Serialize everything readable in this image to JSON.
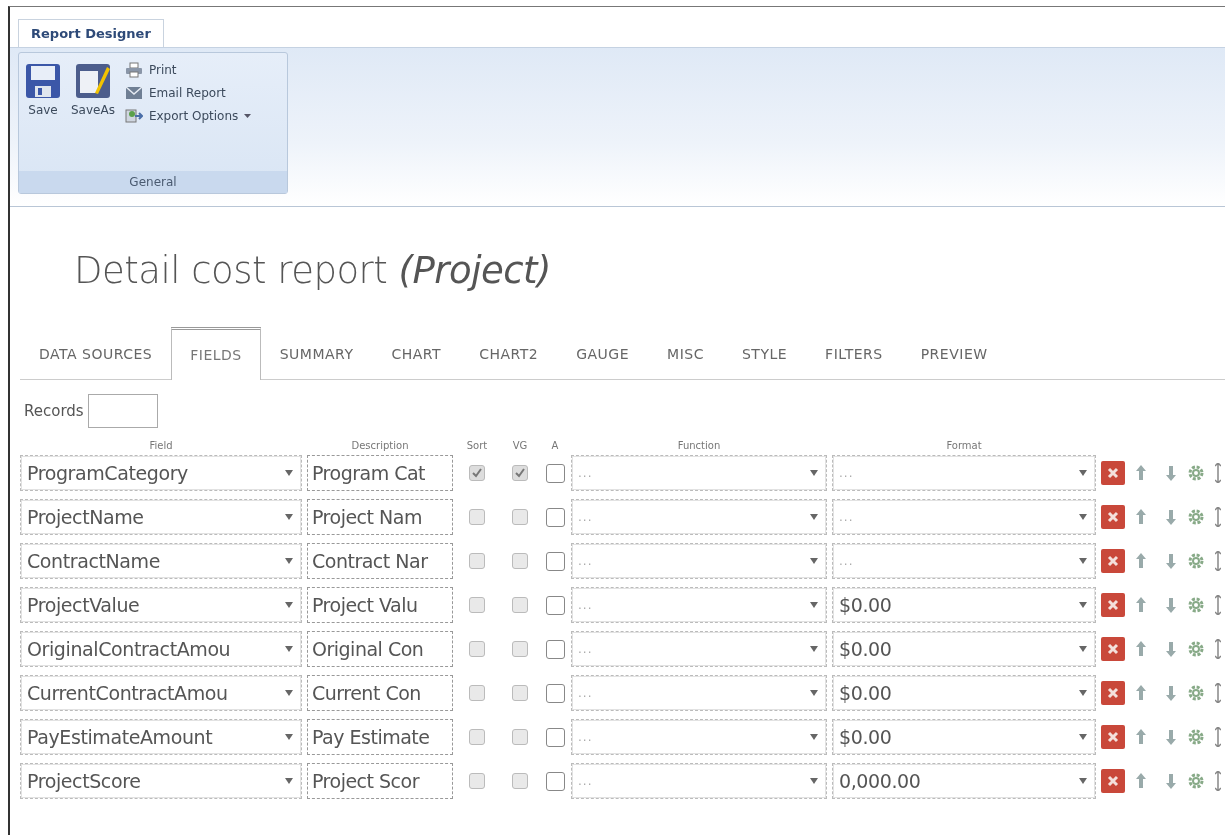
{
  "ribbon": {
    "tab": "Report Designer",
    "group": "General",
    "large_buttons": [
      {
        "kind": "save",
        "label": "Save"
      },
      {
        "kind": "saveas",
        "label": "SaveAs"
      }
    ],
    "small_buttons": [
      {
        "kind": "print",
        "label": "Print"
      },
      {
        "kind": "email",
        "label": "Email Report"
      },
      {
        "kind": "export",
        "label": "Export Options",
        "dropdown": true
      }
    ]
  },
  "title": "Detail cost report *(Project)*",
  "tabs": [
    {
      "label": "DATA SOURCES",
      "selected": false
    },
    {
      "label": "FIELDS",
      "selected": true
    },
    {
      "label": "SUMMARY",
      "selected": false
    },
    {
      "label": "CHART",
      "selected": false
    },
    {
      "label": "CHART2",
      "selected": false
    },
    {
      "label": "GAUGE",
      "selected": false
    },
    {
      "label": "MISC",
      "selected": false
    },
    {
      "label": "STYLE",
      "selected": false
    },
    {
      "label": "FILTERS",
      "selected": false
    },
    {
      "label": "PREVIEW",
      "selected": false
    }
  ],
  "records": {
    "label": "Records"
  },
  "columns": [
    "Field",
    "Description",
    "Sort",
    "VG",
    "A",
    "Function",
    "Format"
  ],
  "rows": [
    {
      "field": "ProgramCategory",
      "description": "Program Cat",
      "sort": true,
      "vg": true,
      "a": false,
      "function": {
        "placeholder": "..."
      },
      "format": {
        "placeholder": "..."
      }
    },
    {
      "field": "ProjectName",
      "description": "Project Nam",
      "sort": false,
      "vg": false,
      "a": false,
      "function": {
        "placeholder": "..."
      },
      "format": {
        "placeholder": "..."
      }
    },
    {
      "field": "ContractName",
      "description": "Contract Nar",
      "sort": false,
      "vg": false,
      "a": false,
      "function": {
        "placeholder": "..."
      },
      "format": {
        "placeholder": "..."
      }
    },
    {
      "field": "ProjectValue",
      "description": "Project Valu",
      "sort": false,
      "vg": false,
      "a": false,
      "function": {
        "placeholder": "..."
      },
      "format": {
        "value": "$0.00"
      }
    },
    {
      "field": "OriginalContractAmou",
      "description": "Original Con",
      "sort": false,
      "vg": false,
      "a": false,
      "function": {
        "placeholder": "..."
      },
      "format": {
        "value": "$0.00"
      }
    },
    {
      "field": "CurrentContractAmou",
      "description": "Current Con",
      "sort": false,
      "vg": false,
      "a": false,
      "function": {
        "placeholder": "..."
      },
      "format": {
        "value": "$0.00"
      }
    },
    {
      "field": "PayEstimateAmount",
      "description": "Pay Estimate",
      "sort": false,
      "vg": false,
      "a": false,
      "function": {
        "placeholder": "..."
      },
      "format": {
        "value": "$0.00"
      }
    },
    {
      "field": "ProjectScore",
      "description": "Project Scor",
      "sort": false,
      "vg": false,
      "a": false,
      "function": {
        "placeholder": "..."
      },
      "format": {
        "value": "0,000.00"
      }
    }
  ]
}
